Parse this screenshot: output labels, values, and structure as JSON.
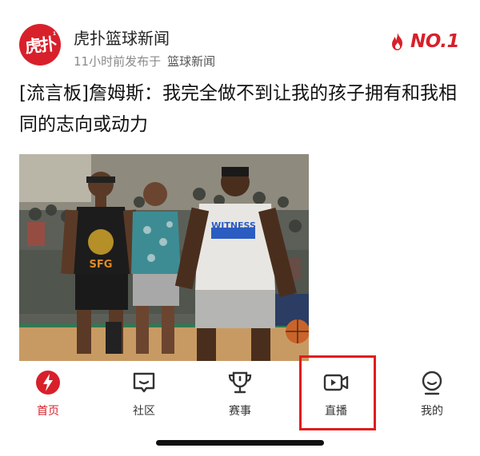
{
  "header": {
    "avatar_text": "虎扑",
    "avatar_small": "1",
    "author": "虎扑篮球新闻",
    "time": "11小时前发布于",
    "category": "篮球新闻",
    "rank": "NO.1"
  },
  "article": {
    "title": "[流言板]詹姆斯：我完全做不到让我的孩子拥有和我相同的志向或动力",
    "image_alt": "basketball-camp-photo"
  },
  "photo": {
    "jersey_1_text": "SFG",
    "shirt_text": "WITNESS"
  },
  "nav": {
    "items": [
      {
        "label": "首页",
        "icon": "lightning-icon",
        "active": true
      },
      {
        "label": "社区",
        "icon": "chat-icon",
        "active": false
      },
      {
        "label": "赛事",
        "icon": "trophy-icon",
        "active": false
      },
      {
        "label": "直播",
        "icon": "live-video-icon",
        "active": false
      },
      {
        "label": "我的",
        "icon": "profile-icon",
        "active": false
      }
    ]
  },
  "colors": {
    "brand_red": "#d8202b",
    "highlight_red": "#e01d1d",
    "text_gray": "#8a8a8a"
  }
}
